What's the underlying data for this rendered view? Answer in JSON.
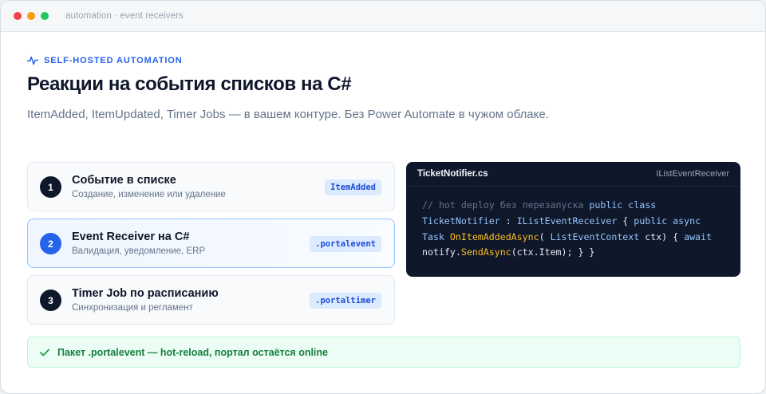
{
  "window": {
    "title": "automation · event receivers"
  },
  "hero": {
    "eyebrow": "SELF-HOSTED AUTOMATION",
    "eyebrow_icon": "activity-pulse-icon",
    "headline": "Реакции на события списков на C#",
    "subtitle": "ItemAdded, ItemUpdated, Timer Jobs — в вашем контуре. Без Power Automate в чужом облаке."
  },
  "steps": [
    {
      "number": "1",
      "title": "Событие в списке",
      "description": "Создание, изменение или удаление",
      "tag": "ItemAdded"
    },
    {
      "number": "2",
      "title": "Event Receiver на C#",
      "description": "Валидация, уведомление, ERP",
      "tag": ".portalevent"
    },
    {
      "number": "3",
      "title": "Timer Job по расписанию",
      "description": "Синхронизация и регламент",
      "tag": ".portaltimer"
    }
  ],
  "code": {
    "filename": "TicketNotifier.cs",
    "interface": "IListEventReceiver",
    "tokens": {
      "comment": "// hot deploy без перезапуска",
      "kw_public": "public",
      "kw_class": "class",
      "class_name": "TicketNotifier",
      "colon": " : ",
      "iface": "IListEventReceiver",
      "brace_open": " { ",
      "kw_public2": "public",
      "kw_async": "async",
      "type_task": "Task",
      "method": "OnItemAddedAsync",
      "paren_open": "( ",
      "param_type": "ListEventContext",
      "param_rest": " ctx) { ",
      "kw_await": "await",
      "notify": "notify.",
      "send": "SendAsync",
      "call_rest": "(ctx.Item); } }"
    }
  },
  "banner": {
    "icon": "check-icon",
    "text": "Пакет .portalevent — hot-reload, портал остаётся online"
  },
  "colors": {
    "accent": "#2563eb",
    "success": "#15803d",
    "code_bg": "#0f172a"
  }
}
